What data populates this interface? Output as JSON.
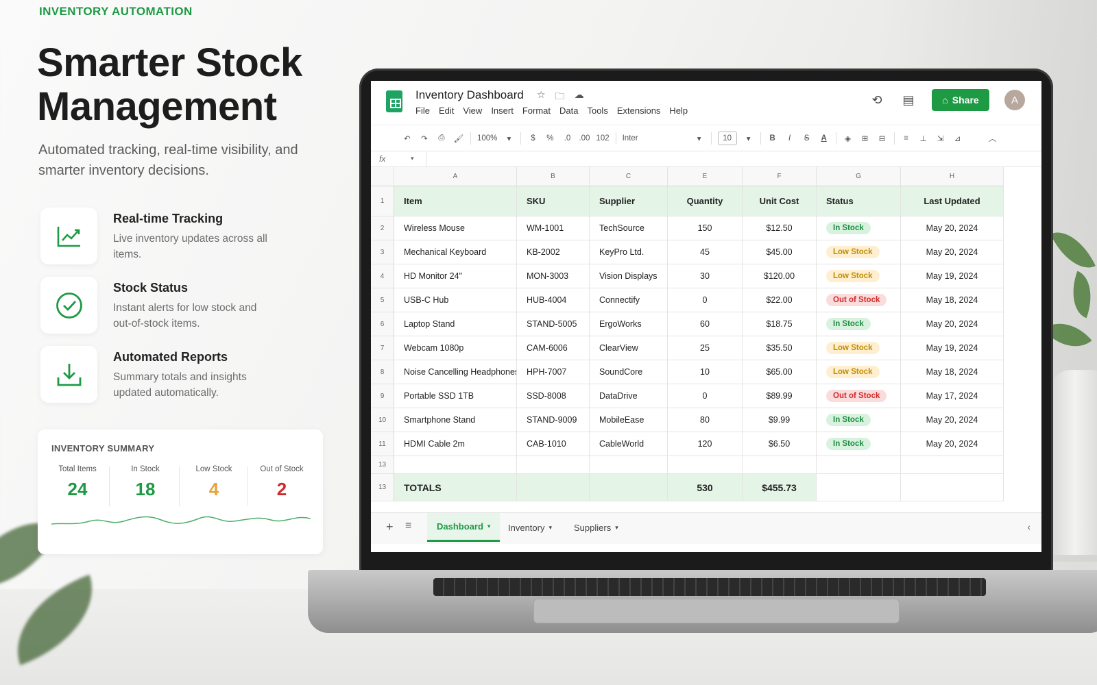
{
  "hero": {
    "eyebrow": "INVENTORY AUTOMATION",
    "headline": "Smarter Stock Management",
    "subtitle": "Automated tracking, real-time visibility, and smarter inventory decisions."
  },
  "features": [
    {
      "icon": "trend-chart-icon",
      "title": "Real-time Tracking",
      "desc": "Live inventory updates across all items."
    },
    {
      "icon": "check-circle-icon",
      "title": "Stock Status",
      "desc": "Instant alerts for low stock and out-of-stock items."
    },
    {
      "icon": "download-icon",
      "title": "Automated Reports",
      "desc": "Summary totals and insights updated automatically."
    }
  ],
  "summary": {
    "title": "INVENTORY SUMMARY",
    "stats": [
      {
        "label": "Total Items",
        "value": "24",
        "color": "#1e9a45"
      },
      {
        "label": "In Stock",
        "value": "18",
        "color": "#1e9a45"
      },
      {
        "label": "Low Stock",
        "value": "4",
        "color": "#e6a23c"
      },
      {
        "label": "Out of Stock",
        "value": "2",
        "color": "#d12a2a"
      }
    ]
  },
  "sheet": {
    "title": "Inventory Dashboard",
    "menu": [
      "File",
      "Edit",
      "View",
      "Insert",
      "Format",
      "Data",
      "Tools",
      "Extensions",
      "Help"
    ],
    "share_label": "Share",
    "avatar_initial": "A",
    "toolbar": {
      "zoom": "100%",
      "currency": "$",
      "percent": "%",
      "dec_less": ".0",
      "dec_more": ".00",
      "number_format": "102",
      "font": "Inter",
      "font_size": "10",
      "bold": "B",
      "italic": "I",
      "strike": "S",
      "text_color": "A"
    },
    "formula_label": "fx",
    "columns": [
      "A",
      "B",
      "C",
      "E",
      "F",
      "G",
      "H"
    ],
    "headers": [
      "Item",
      "SKU",
      "Supplier",
      "Quantity",
      "Unit Cost",
      "Status",
      "Last Updated"
    ],
    "rows": [
      {
        "num": "2",
        "item": "Wireless Mouse",
        "sku": "WM-1001",
        "supplier": "TechSource",
        "qty": "150",
        "cost": "$12.50",
        "status": "In Stock",
        "updated": "May 20, 2024"
      },
      {
        "num": "3",
        "item": "Mechanical Keyboard",
        "sku": "KB-2002",
        "supplier": "KeyPro Ltd.",
        "qty": "45",
        "cost": "$45.00",
        "status": "Low Stock",
        "updated": "May 20, 2024"
      },
      {
        "num": "4",
        "item": "HD Monitor 24\"",
        "sku": "MON-3003",
        "supplier": "Vision Displays",
        "qty": "30",
        "cost": "$120.00",
        "status": "Low Stock",
        "updated": "May 19, 2024"
      },
      {
        "num": "5",
        "item": "USB-C Hub",
        "sku": "HUB-4004",
        "supplier": "Connectify",
        "qty": "0",
        "cost": "$22.00",
        "status": "Out of Stock",
        "updated": "May 18, 2024"
      },
      {
        "num": "6",
        "item": "Laptop Stand",
        "sku": "STAND-5005",
        "supplier": "ErgoWorks",
        "qty": "60",
        "cost": "$18.75",
        "status": "In Stock",
        "updated": "May 20, 2024"
      },
      {
        "num": "7",
        "item": "Webcam 1080p",
        "sku": "CAM-6006",
        "supplier": "ClearView",
        "qty": "25",
        "cost": "$35.50",
        "status": "Low Stock",
        "updated": "May 19, 2024"
      },
      {
        "num": "8",
        "item": "Noise Cancelling Headphones",
        "sku": "HPH-7007",
        "supplier": "SoundCore",
        "qty": "10",
        "cost": "$65.00",
        "status": "Low Stock",
        "updated": "May 18, 2024"
      },
      {
        "num": "9",
        "item": "Portable SSD 1TB",
        "sku": "SSD-8008",
        "supplier": "DataDrive",
        "qty": "0",
        "cost": "$89.99",
        "status": "Out of Stock",
        "updated": "May 17, 2024"
      },
      {
        "num": "10",
        "item": "Smartphone Stand",
        "sku": "STAND-9009",
        "supplier": "MobileEase",
        "qty": "80",
        "cost": "$9.99",
        "status": "In Stock",
        "updated": "May 20, 2024"
      },
      {
        "num": "11",
        "item": "HDMI Cable 2m",
        "sku": "CAB-1010",
        "supplier": "CableWorld",
        "qty": "120",
        "cost": "$6.50",
        "status": "In Stock",
        "updated": "May 20, 2024"
      }
    ],
    "blank_row_num": "13",
    "totals": {
      "num": "13",
      "label": "TOTALS",
      "qty": "530",
      "cost": "$455.73"
    },
    "tabs": [
      "Dashboard",
      "Inventory",
      "Suppliers"
    ],
    "active_tab": "Dashboard",
    "status_colors": {
      "In Stock": "#1b8a3e",
      "Low Stock": "#c58a00",
      "Out of Stock": "#d12a2a"
    }
  }
}
